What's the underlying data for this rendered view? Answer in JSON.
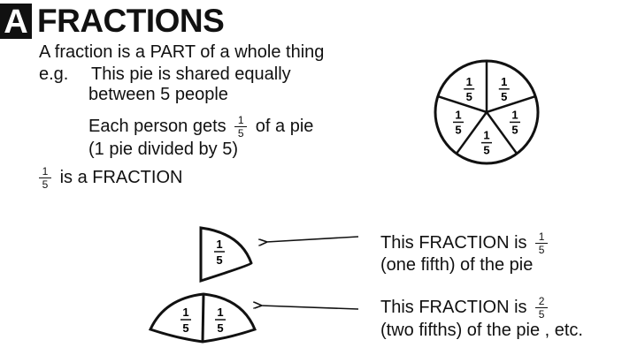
{
  "badge": "A",
  "title": "FRACTIONS",
  "intro": "A fraction is a PART of a whole thing",
  "eg_label": "e.g.",
  "eg_line1": "This pie is shared equally",
  "eg_line2": "between 5 people",
  "gets_prefix": "Each person gets",
  "gets_suffix": "of a pie",
  "gets_line2": "(1 pie divided by 5)",
  "fraction_statement": "is a FRACTION",
  "pie": {
    "numerator": "1",
    "denominator": "5",
    "slices": 5
  },
  "examples": [
    {
      "prefix": "This FRACTION is",
      "numerator": "1",
      "denominator": "5",
      "line2": "(one fifth) of the pie"
    },
    {
      "prefix": "This FRACTION is",
      "numerator": "2",
      "denominator": "5",
      "line2": "(two fifths) of the pie , etc."
    }
  ],
  "one_fifth": {
    "numerator": "1",
    "denominator": "5"
  }
}
